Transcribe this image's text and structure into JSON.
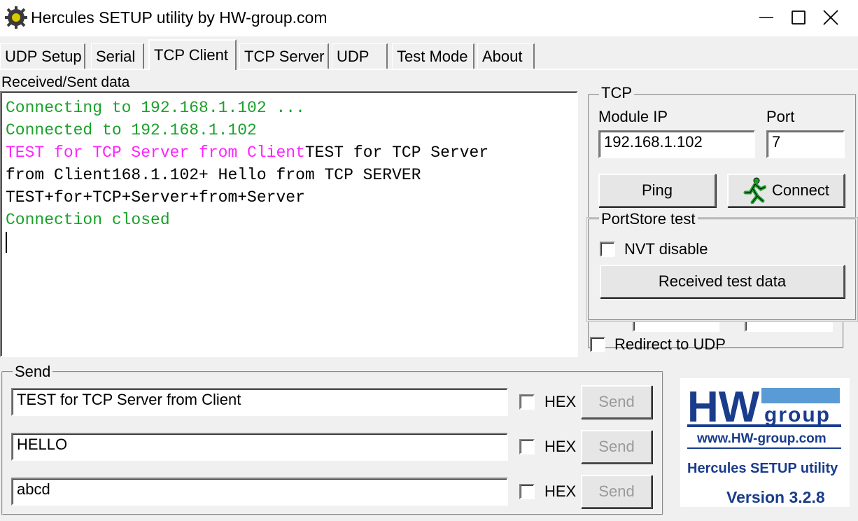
{
  "window": {
    "title": "Hercules SETUP utility by HW-group.com"
  },
  "tabs": [
    {
      "label": "UDP Setup"
    },
    {
      "label": "Serial"
    },
    {
      "label": "TCP Client"
    },
    {
      "label": "TCP Server"
    },
    {
      "label": "UDP"
    },
    {
      "label": "Test Mode"
    },
    {
      "label": "About"
    }
  ],
  "received": {
    "label": "Received/Sent data",
    "lines": [
      [
        {
          "text": "Connecting to 192.168.1.102 ...",
          "color": "green"
        }
      ],
      [
        {
          "text": "Connected to 192.168.1.102",
          "color": "green"
        }
      ],
      [
        {
          "text": "TEST for TCP Server from Client",
          "color": "magenta"
        },
        {
          "text": "TEST for TCP Server",
          "color": "black"
        }
      ],
      [
        {
          "text": "from Client168.1.102+ Hello from TCP SERVER",
          "color": "black"
        }
      ],
      [
        {
          "text": "TEST+for+TCP+Server+from+Server",
          "color": "black"
        }
      ],
      [
        {
          "text": "Connection closed",
          "color": "green"
        }
      ]
    ]
  },
  "tcp": {
    "group_label": "TCP",
    "module_ip_label": "Module IP",
    "module_ip_value": "192.168.1.102",
    "port_label": "Port",
    "port_value": "7",
    "ping_label": "Ping",
    "connect_label": "Connect"
  },
  "portstore": {
    "group_label": "PortStore test",
    "nvt_label": "NVT disable",
    "received_test_label": "Received test data"
  },
  "redirect": {
    "label": "Redirect to UDP"
  },
  "send": {
    "group_label": "Send",
    "rows": [
      {
        "value": "TEST for TCP Server from Client",
        "hex_label": "HEX",
        "send_label": "Send"
      },
      {
        "value": "HELLO",
        "hex_label": "HEX",
        "send_label": "Send"
      },
      {
        "value": "abcd",
        "hex_label": "HEX",
        "send_label": "Send"
      }
    ]
  },
  "logo": {
    "brand_hw": "HW",
    "brand_group": "group",
    "url": "www.HW-group.com",
    "product": "Hercules SETUP utility",
    "version": "Version  3.2.8"
  },
  "colors": {
    "green": "#1aa12a",
    "magenta": "#ff22ff",
    "logo_blue": "#1a3c8c",
    "logo_lightblue": "#5b9bd5"
  }
}
